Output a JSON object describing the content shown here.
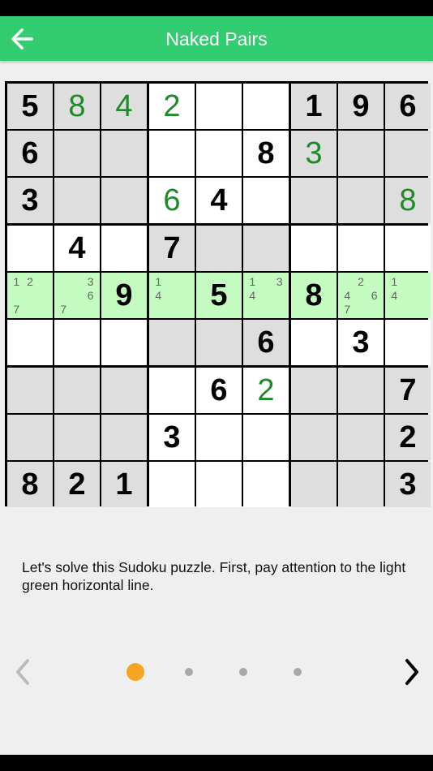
{
  "header": {
    "title": "Naked Pairs",
    "back_icon": "arrow-left-icon"
  },
  "board": {
    "rows": [
      [
        {
          "v": "5",
          "t": "given"
        },
        {
          "v": "8",
          "t": "user"
        },
        {
          "v": "4",
          "t": "user"
        },
        {
          "v": "2",
          "t": "user"
        },
        {},
        {},
        {
          "v": "1",
          "t": "given"
        },
        {
          "v": "9",
          "t": "given"
        },
        {
          "v": "6",
          "t": "given"
        }
      ],
      [
        {
          "v": "6",
          "t": "given"
        },
        {},
        {},
        {},
        {},
        {
          "v": "8",
          "t": "given"
        },
        {
          "v": "3",
          "t": "user"
        },
        {},
        {}
      ],
      [
        {
          "v": "3",
          "t": "given"
        },
        {},
        {},
        {
          "v": "6",
          "t": "user"
        },
        {
          "v": "4",
          "t": "given"
        },
        {},
        {},
        {},
        {
          "v": "8",
          "t": "user"
        }
      ],
      [
        {},
        {
          "v": "4",
          "t": "given"
        },
        {},
        {
          "v": "7",
          "t": "given"
        },
        {},
        {},
        {},
        {},
        {}
      ],
      [
        {
          "c": [
            "1",
            "2",
            "",
            "",
            "",
            "",
            "7",
            "",
            ""
          ]
        },
        {
          "c": [
            "",
            "",
            "3",
            "",
            "",
            "6",
            "7",
            "",
            ""
          ]
        },
        {
          "v": "9",
          "t": "given"
        },
        {
          "c": [
            "1",
            "",
            "",
            "4",
            "",
            "",
            "",
            "",
            ""
          ]
        },
        {
          "v": "5",
          "t": "given"
        },
        {
          "c": [
            "1",
            "",
            "3",
            "4",
            "",
            "",
            "",
            "",
            ""
          ]
        },
        {
          "v": "8",
          "t": "given"
        },
        {
          "c": [
            "",
            "2",
            "",
            "4",
            "",
            "6",
            "7",
            "",
            ""
          ]
        },
        {
          "c": [
            "1",
            "",
            "",
            "4",
            "",
            "",
            "",
            "",
            ""
          ]
        }
      ],
      [
        {},
        {},
        {},
        {},
        {},
        {
          "v": "6",
          "t": "given"
        },
        {},
        {
          "v": "3",
          "t": "given"
        },
        {}
      ],
      [
        {},
        {},
        {},
        {},
        {
          "v": "6",
          "t": "given"
        },
        {
          "v": "2",
          "t": "user"
        },
        {},
        {},
        {
          "v": "7",
          "t": "given"
        }
      ],
      [
        {},
        {},
        {},
        {
          "v": "3",
          "t": "given"
        },
        {},
        {},
        {},
        {},
        {
          "v": "2",
          "t": "given"
        }
      ],
      [
        {
          "v": "8",
          "t": "given"
        },
        {
          "v": "2",
          "t": "given"
        },
        {
          "v": "1",
          "t": "given"
        },
        {},
        {},
        {},
        {},
        {},
        {
          "v": "3",
          "t": "given"
        }
      ]
    ],
    "highlight_row": 4,
    "gray_boxes": [
      0,
      2,
      4,
      6,
      8
    ],
    "colors": {
      "highlight": "#c3fbc0",
      "gray": "#dedede",
      "given_digit": "#000000",
      "user_digit": "#1e8a2a",
      "candidate": "#666666"
    }
  },
  "instruction": "Let's solve this Sudoku puzzle. First, pay attention to the light green horizontal line.",
  "pager": {
    "prev_icon": "chevron-left-icon",
    "next_icon": "chevron-right-icon",
    "total_pages": 4,
    "current_page": 1
  },
  "colors": {
    "header": "#33cc70",
    "active_dot": "#f5a522",
    "inactive_dot": "#a8a8a8"
  }
}
